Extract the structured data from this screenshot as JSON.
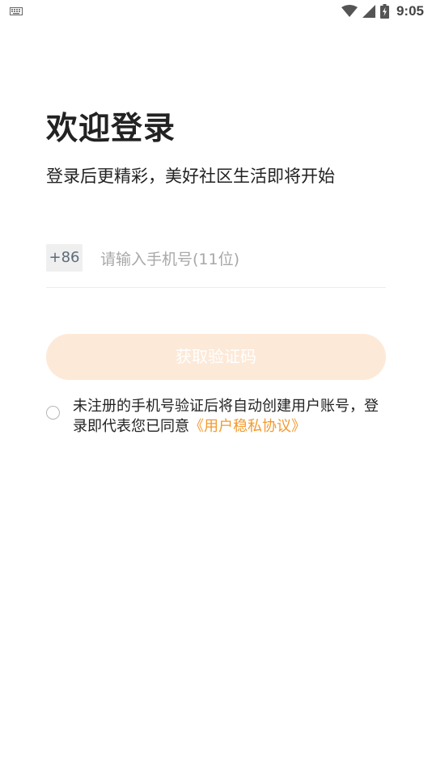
{
  "status_bar": {
    "time": "9:05",
    "icons": [
      "keyboard-icon",
      "wifi-icon",
      "signal-icon",
      "battery-charging-icon"
    ]
  },
  "login": {
    "title": "欢迎登录",
    "subtitle": "登录后更精彩，美好社区生活即将开始",
    "country_code": "+86",
    "phone_placeholder": "请输入手机号(11位)",
    "phone_value": "",
    "get_code_label": "获取验证码",
    "agreement_text_part1": "未注册的手机号验证后将自动创建用户账号，登录即代表您已同意",
    "agreement_link": "《用户稳私协议》",
    "agreement_checked": false
  },
  "colors": {
    "accent": "#f39a2e",
    "button_disabled_bg": "#fde9d8",
    "country_code_bg": "#efefef"
  }
}
